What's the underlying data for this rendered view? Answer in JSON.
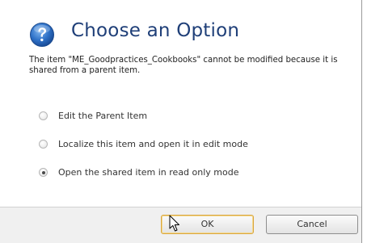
{
  "dialog": {
    "title": "Choose an Option",
    "message": "The item \"ME_Goodpractices_Cookbooks\" cannot be modified because it is shared from a parent item.",
    "icon": "help-icon",
    "accent_color": "#1f3f78"
  },
  "options": [
    {
      "label": "Edit the Parent Item",
      "selected": false
    },
    {
      "label": "Localize this item and open it in edit mode",
      "selected": false
    },
    {
      "label": "Open the shared item in read only mode",
      "selected": true
    }
  ],
  "buttons": {
    "ok_label": "OK",
    "cancel_label": "Cancel"
  }
}
